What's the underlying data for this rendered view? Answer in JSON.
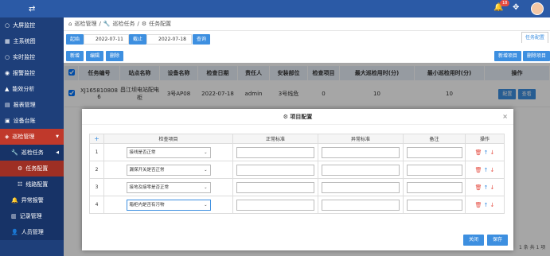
{
  "topbar": {
    "notif_count": "18"
  },
  "sidebar": {
    "items": [
      {
        "label": "大屏监控",
        "icon": "circle-icon",
        "kind": "top"
      },
      {
        "label": "主系统图",
        "icon": "grid-icon",
        "kind": "top"
      },
      {
        "label": "实时监控",
        "icon": "circle-icon",
        "kind": "top"
      },
      {
        "label": "报警监控",
        "icon": "alarm-icon",
        "kind": "top"
      },
      {
        "label": "能效分析",
        "icon": "chart-icon",
        "kind": "top"
      },
      {
        "label": "报表管理",
        "icon": "doc-icon",
        "kind": "top"
      },
      {
        "label": "设备台账",
        "icon": "device-icon",
        "kind": "top"
      },
      {
        "label": "巡检管理",
        "icon": "inspect-icon",
        "kind": "top-active"
      },
      {
        "label": "巡检任务",
        "icon": "wrench-icon",
        "kind": "sub"
      },
      {
        "label": "任务配置",
        "icon": "config-icon",
        "kind": "sub2-active"
      },
      {
        "label": "线路配置",
        "icon": "route-icon",
        "kind": "sub2"
      },
      {
        "label": "异常报警",
        "icon": "bell-icon",
        "kind": "sub"
      },
      {
        "label": "记录管理",
        "icon": "record-icon",
        "kind": "sub"
      },
      {
        "label": "人员管理",
        "icon": "user-icon",
        "kind": "sub"
      }
    ]
  },
  "breadcrumb": {
    "l1": "巡检管理",
    "l2": "巡检任务",
    "l3": "任务配置"
  },
  "filter": {
    "start_label": "起始",
    "start_date": "2022-07-11",
    "end_label": "截止",
    "end_date": "2022-07-18",
    "query": "查询"
  },
  "tab_right": "任务配置",
  "toolbar": {
    "add": "新增",
    "edit": "编辑",
    "delete": "删除",
    "add_item": "新增项目",
    "delete_item": "删除项目"
  },
  "table": {
    "headers": [
      "任务编号",
      "站点名称",
      "设备名称",
      "检查日期",
      "责任人",
      "安装部位",
      "检查项目",
      "最大巡检用时(分)",
      "最小巡检用时(分)",
      "操作"
    ],
    "row": {
      "task_no": "XJ165810808 6",
      "site": "昌江坝电站配电柜",
      "device": "3号AP08",
      "date": "2022-07-18",
      "person": "admin",
      "location": "3号线危",
      "items": "0",
      "max": "10",
      "min": "10",
      "config": "配置",
      "view": "查看"
    }
  },
  "pager": "1 条 共 1 项",
  "modal": {
    "title": "项目配置",
    "headers": [
      "检查项目",
      "正常标准",
      "异常标准",
      "备注",
      "操作"
    ],
    "add_symbol": "+",
    "rows": [
      {
        "no": "1",
        "item": "接线是否正常"
      },
      {
        "no": "2",
        "item": "漏保开关是否正常"
      },
      {
        "no": "3",
        "item": "接地及接零是否正常"
      },
      {
        "no": "4",
        "item": "箱柜内是否有污物"
      }
    ],
    "close": "关闭",
    "save": "保存"
  }
}
